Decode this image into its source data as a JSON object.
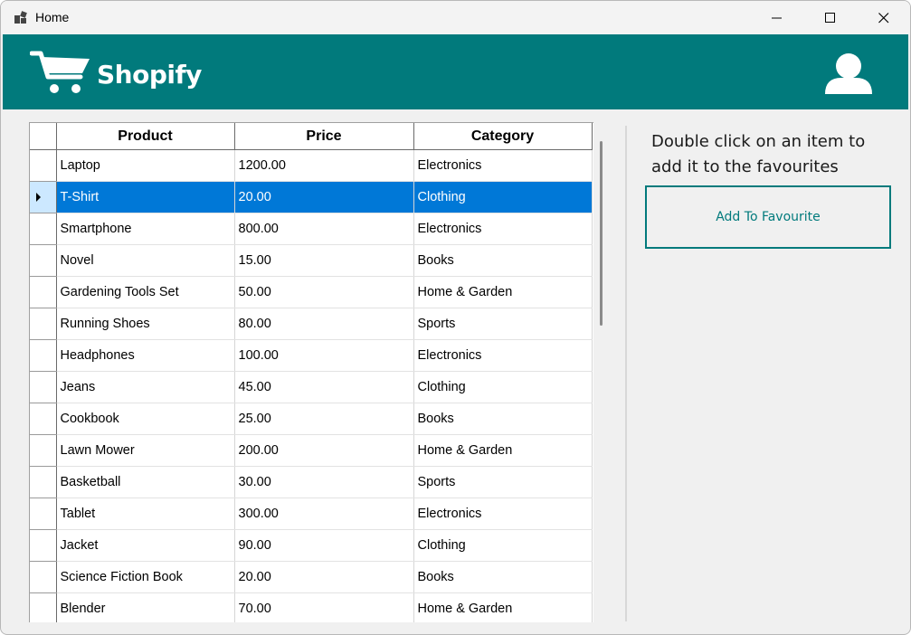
{
  "window": {
    "title": "Home"
  },
  "header": {
    "brand": "Shopify",
    "accent": "#017a7c"
  },
  "grid": {
    "columns": [
      "Product",
      "Price",
      "Category"
    ],
    "selected_row_index": 1,
    "selection_color": "#0078d7",
    "rows": [
      [
        "Laptop",
        "1200.00",
        "Electronics"
      ],
      [
        "T-Shirt",
        "20.00",
        "Clothing"
      ],
      [
        "Smartphone",
        "800.00",
        "Electronics"
      ],
      [
        "Novel",
        "15.00",
        "Books"
      ],
      [
        "Gardening Tools Set",
        "50.00",
        "Home & Garden"
      ],
      [
        "Running Shoes",
        "80.00",
        "Sports"
      ],
      [
        "Headphones",
        "100.00",
        "Electronics"
      ],
      [
        "Jeans",
        "45.00",
        "Clothing"
      ],
      [
        "Cookbook",
        "25.00",
        "Books"
      ],
      [
        "Lawn Mower",
        "200.00",
        "Home & Garden"
      ],
      [
        "Basketball",
        "30.00",
        "Sports"
      ],
      [
        "Tablet",
        "300.00",
        "Electronics"
      ],
      [
        "Jacket",
        "90.00",
        "Clothing"
      ],
      [
        "Science Fiction Book",
        "20.00",
        "Books"
      ],
      [
        "Blender",
        "70.00",
        "Home & Garden"
      ]
    ]
  },
  "side_panel": {
    "hint": "Double click on an item to add it to the favourites",
    "add_button_label": "Add To Favourite"
  }
}
